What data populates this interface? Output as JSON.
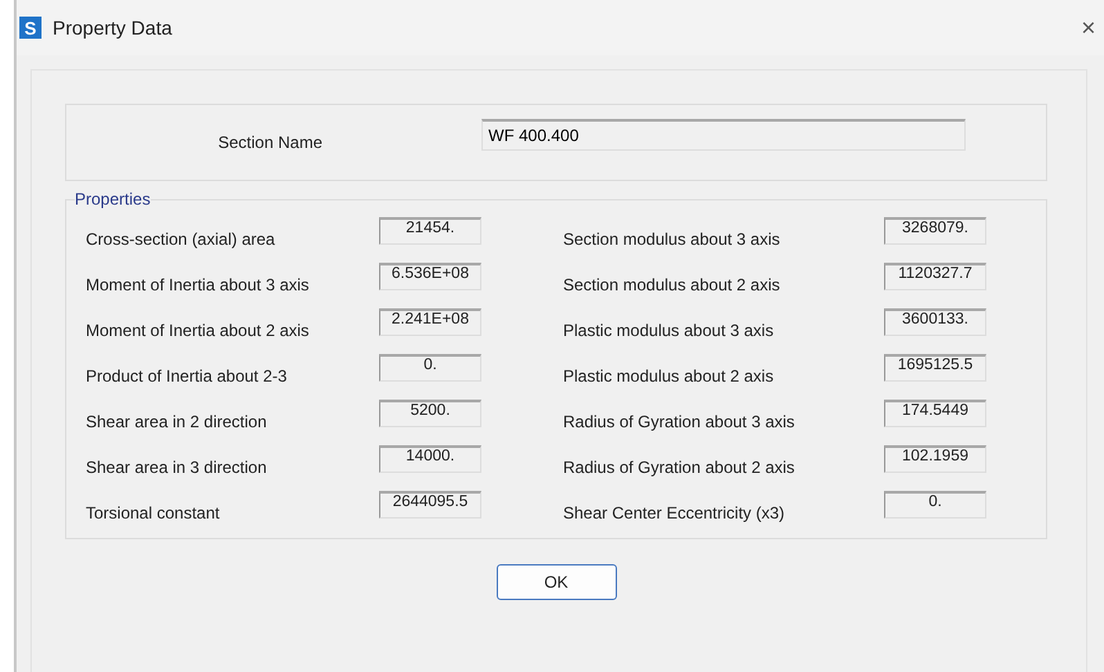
{
  "window": {
    "icon": "S",
    "title": "Property Data",
    "close": "×"
  },
  "section_name": {
    "label": "Section Name",
    "value": "WF 400.400"
  },
  "properties": {
    "title": "Properties",
    "left": [
      {
        "label": "Cross-section (axial) area",
        "value": "21454."
      },
      {
        "label": "Moment of Inertia about 3 axis",
        "value": "6.536E+08"
      },
      {
        "label": "Moment of Inertia about 2 axis",
        "value": "2.241E+08"
      },
      {
        "label": "Product of Inertia about 2-3",
        "value": "0."
      },
      {
        "label": "Shear area in 2 direction",
        "value": "5200."
      },
      {
        "label": "Shear area in 3 direction",
        "value": "14000."
      },
      {
        "label": "Torsional constant",
        "value": "2644095.5"
      }
    ],
    "right": [
      {
        "label": "Section modulus about 3 axis",
        "value": "3268079."
      },
      {
        "label": "Section modulus about 2 axis",
        "value": "1120327.7"
      },
      {
        "label": "Plastic modulus about 3 axis",
        "value": "3600133."
      },
      {
        "label": "Plastic modulus about 2 axis",
        "value": "1695125.5"
      },
      {
        "label": "Radius of Gyration about 3 axis",
        "value": "174.5449"
      },
      {
        "label": "Radius of Gyration about 2 axis",
        "value": "102.1959"
      },
      {
        "label": "Shear Center Eccentricity (x3)",
        "value": "0."
      }
    ]
  },
  "buttons": [
    "OK"
  ]
}
